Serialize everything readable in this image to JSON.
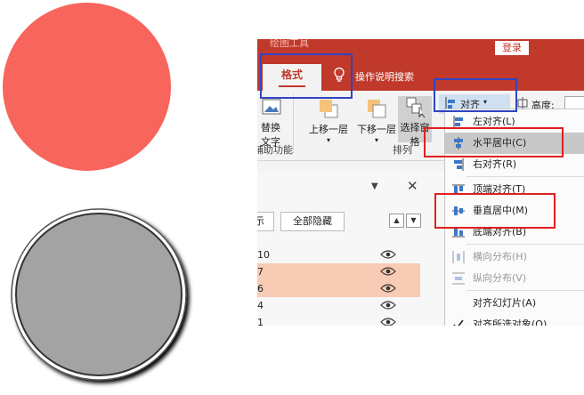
{
  "colors": {
    "red_circle": "#f8655c",
    "gray_circle": "#a3a3a3",
    "accent": "#c0392b",
    "blue_box": "#3044c4",
    "red_box": "#e02020",
    "row_selected": "#f8cbb5"
  },
  "window": {
    "title": "绘图工具",
    "login": "登录"
  },
  "tabs": {
    "format": "格式",
    "search_icon": "lightbulb-icon",
    "search": "操作说明搜索"
  },
  "ribbon": {
    "alt_text": [
      "替换",
      "文字"
    ],
    "bring_forward": "上移一层",
    "send_backward": "下移一层",
    "selection_pane": "选择窗格",
    "align": "对齐",
    "height_label": "高度:",
    "groups": {
      "assist": "辅助功能",
      "arrange": "排列"
    }
  },
  "pane": {
    "show_partial": "显示",
    "hide_all": "全部隐藏",
    "items": [
      {
        "name": "10",
        "selected": false
      },
      {
        "name": "7",
        "selected": true
      },
      {
        "name": "6",
        "selected": true
      },
      {
        "name": "4",
        "selected": false
      },
      {
        "name": "1",
        "selected": false
      }
    ]
  },
  "align_menu": {
    "items": [
      {
        "label": "左对齐(L)",
        "icon": "align-left-icon",
        "enabled": true,
        "highlighted": false
      },
      {
        "label": "水平居中(C)",
        "icon": "align-center-icon",
        "enabled": true,
        "highlighted": true
      },
      {
        "label": "右对齐(R)",
        "icon": "align-right-icon",
        "enabled": true,
        "highlighted": false
      },
      {
        "label": "顶端对齐(T)",
        "icon": "align-top-icon",
        "enabled": true,
        "highlighted": false
      },
      {
        "label": "垂直居中(M)",
        "icon": "align-middle-icon",
        "enabled": true,
        "highlighted": false
      },
      {
        "label": "底端对齐(B)",
        "icon": "align-bottom-icon",
        "enabled": true,
        "highlighted": false
      },
      {
        "label": "横向分布(H)",
        "icon": "distribute-horizontal-icon",
        "enabled": false,
        "highlighted": false
      },
      {
        "label": "纵向分布(V)",
        "icon": "distribute-vertical-icon",
        "enabled": false,
        "highlighted": false
      },
      {
        "label": "对齐幻灯片(A)",
        "icon": "",
        "enabled": true,
        "highlighted": false
      },
      {
        "label": "对齐所选对象(O)",
        "icon": "checkmark-icon",
        "enabled": true,
        "highlighted": false
      }
    ]
  }
}
